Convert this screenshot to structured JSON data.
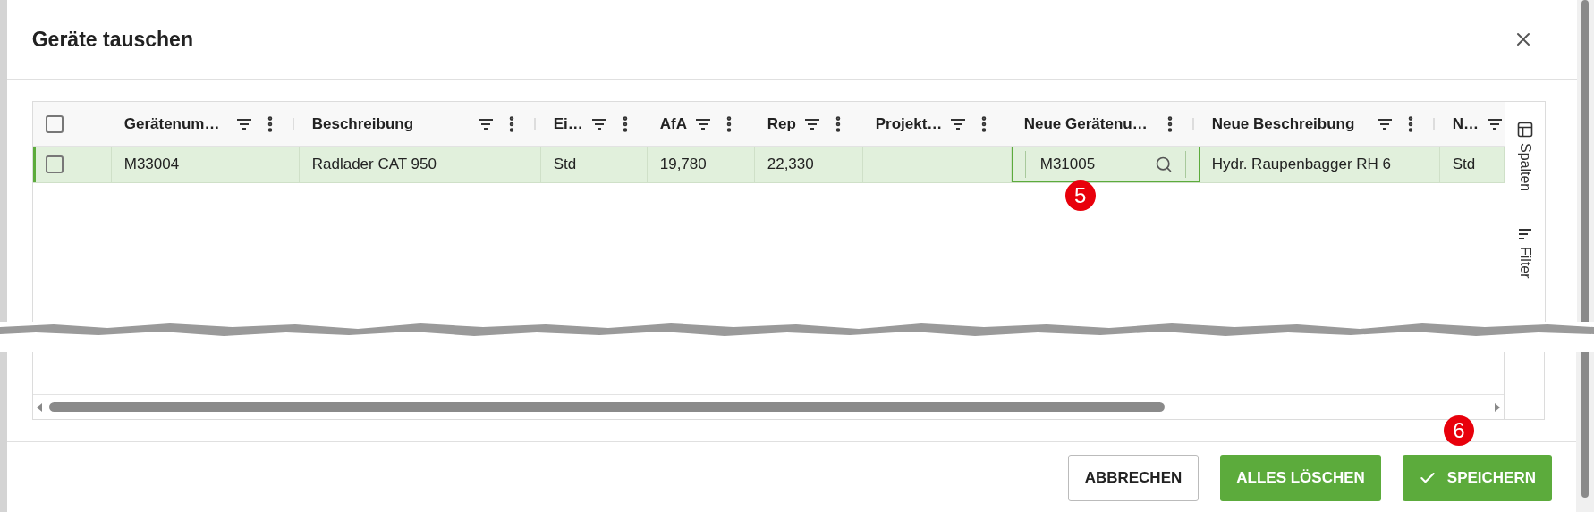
{
  "dialog": {
    "title": "Geräte tauschen"
  },
  "table": {
    "header_checkbox": {
      "checked": false
    },
    "columns": [
      {
        "label": "Gerätenum…",
        "kind": "filter_menu"
      },
      {
        "label": "Beschreibung",
        "kind": "filter_menu"
      },
      {
        "label": "Ei…",
        "kind": "filter_menu"
      },
      {
        "label": "AfA",
        "kind": "filter_menu"
      },
      {
        "label": "Rep",
        "kind": "filter_menu"
      },
      {
        "label": "Projekt…",
        "kind": "filter_menu"
      },
      {
        "label": "Neue Gerätenu…",
        "kind": "menu"
      },
      {
        "label": "Neue Beschreibung",
        "kind": "filter_menu"
      },
      {
        "label": "N…",
        "kind": "filter"
      }
    ],
    "rows": [
      {
        "selected": true,
        "checked": false,
        "cells": [
          {
            "kind": "text",
            "value": "M33004"
          },
          {
            "kind": "text",
            "value": "Radlader CAT 950"
          },
          {
            "kind": "text",
            "value": "Std"
          },
          {
            "kind": "text",
            "value": "19,780"
          },
          {
            "kind": "text",
            "value": "22,330"
          },
          {
            "kind": "empty"
          },
          {
            "kind": "lookup",
            "value": "M31005"
          },
          {
            "kind": "text",
            "value": "Hydr. Raupenbagger RH 6"
          },
          {
            "kind": "text",
            "value": "Std"
          }
        ]
      }
    ]
  },
  "side_panel": [
    {
      "label": "Spalten",
      "kind": "columns"
    },
    {
      "label": "Filter",
      "kind": "filter"
    }
  ],
  "markers": [
    {
      "text": "5"
    },
    {
      "text": "6"
    }
  ],
  "buttons": [
    {
      "label": "ABBRECHEN",
      "kind": "outline"
    },
    {
      "label": "ALLES LÖSCHEN",
      "kind": "primary"
    },
    {
      "label": "SPEICHERN",
      "kind": "primary_check"
    }
  ]
}
